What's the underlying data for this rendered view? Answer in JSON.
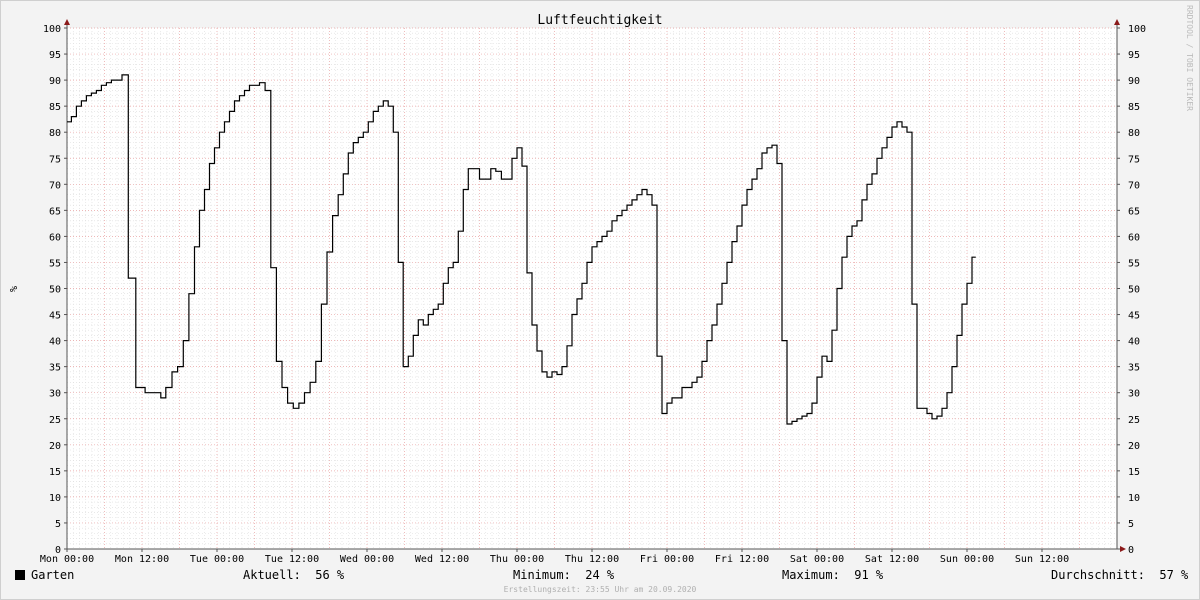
{
  "watermark": "RRDTOOL / TOBI OETIKER",
  "footer": "Erstellungszeit: 23:55 Uhr am 20.09.2020",
  "legend": {
    "series_name": "Garten",
    "current_label": "Aktuell:",
    "current_value": "56 %",
    "min_label": "Minimum:",
    "min_value": "24 %",
    "max_label": "Maximum:",
    "max_value": "91 %",
    "avg_label": "Durchschnitt:",
    "avg_value": "57 %"
  },
  "chart_data": {
    "type": "line",
    "title": "Luftfeuchtigkeit",
    "ylabel": "%",
    "ylim": [
      0,
      100
    ],
    "yticks": [
      0,
      5,
      10,
      15,
      20,
      25,
      30,
      35,
      40,
      45,
      50,
      55,
      60,
      65,
      70,
      75,
      80,
      85,
      90,
      95,
      100
    ],
    "xlim_hours": [
      0,
      168
    ],
    "xticks": [
      {
        "hour": 0,
        "label": "Mon 00:00"
      },
      {
        "hour": 12,
        "label": "Mon 12:00"
      },
      {
        "hour": 24,
        "label": "Tue 00:00"
      },
      {
        "hour": 36,
        "label": "Tue 12:00"
      },
      {
        "hour": 48,
        "label": "Wed 00:00"
      },
      {
        "hour": 60,
        "label": "Wed 12:00"
      },
      {
        "hour": 72,
        "label": "Thu 00:00"
      },
      {
        "hour": 84,
        "label": "Thu 12:00"
      },
      {
        "hour": 96,
        "label": "Fri 00:00"
      },
      {
        "hour": 108,
        "label": "Fri 12:00"
      },
      {
        "hour": 120,
        "label": "Sat 00:00"
      },
      {
        "hour": 132,
        "label": "Sat 12:00"
      },
      {
        "hour": 144,
        "label": "Sun 00:00"
      },
      {
        "hour": 156,
        "label": "Sun 12:00"
      }
    ],
    "grid": true,
    "color": "#000000",
    "series": [
      {
        "name": "Garten",
        "points": [
          [
            0,
            82
          ],
          [
            0.7,
            83
          ],
          [
            1.5,
            85
          ],
          [
            2.3,
            86
          ],
          [
            3.1,
            87
          ],
          [
            3.9,
            87.5
          ],
          [
            4.7,
            88
          ],
          [
            5.5,
            89
          ],
          [
            6.3,
            89.5
          ],
          [
            7.1,
            90
          ],
          [
            8.8,
            91
          ],
          [
            9.8,
            52
          ],
          [
            11,
            31
          ],
          [
            12.5,
            30
          ],
          [
            14.3,
            30
          ],
          [
            15,
            29
          ],
          [
            15.8,
            31
          ],
          [
            16.8,
            34
          ],
          [
            17.7,
            35
          ],
          [
            18.6,
            40
          ],
          [
            19.5,
            49
          ],
          [
            20.4,
            58
          ],
          [
            21.2,
            65
          ],
          [
            22,
            69
          ],
          [
            22.8,
            74
          ],
          [
            23.6,
            77
          ],
          [
            24.4,
            80
          ],
          [
            25.2,
            82
          ],
          [
            26,
            84
          ],
          [
            26.8,
            86
          ],
          [
            27.6,
            87
          ],
          [
            28.4,
            88
          ],
          [
            29.2,
            89
          ],
          [
            30,
            89
          ],
          [
            30.8,
            89.5
          ],
          [
            31.7,
            88
          ],
          [
            32.6,
            54
          ],
          [
            33.5,
            36
          ],
          [
            34.4,
            31
          ],
          [
            35.3,
            28
          ],
          [
            36.2,
            27
          ],
          [
            37.1,
            28
          ],
          [
            38,
            30
          ],
          [
            38.9,
            32
          ],
          [
            39.8,
            36
          ],
          [
            40.7,
            47
          ],
          [
            41.6,
            57
          ],
          [
            42.5,
            64
          ],
          [
            43.4,
            68
          ],
          [
            44.2,
            72
          ],
          [
            45,
            76
          ],
          [
            45.8,
            78
          ],
          [
            46.6,
            79
          ],
          [
            47.4,
            80
          ],
          [
            48.2,
            82
          ],
          [
            49,
            84
          ],
          [
            49.8,
            85
          ],
          [
            50.6,
            86
          ],
          [
            51.4,
            85
          ],
          [
            52.2,
            80
          ],
          [
            53,
            55
          ],
          [
            53.8,
            35
          ],
          [
            54.6,
            37
          ],
          [
            55.4,
            41
          ],
          [
            56.2,
            44
          ],
          [
            57,
            43
          ],
          [
            57.8,
            45
          ],
          [
            58.6,
            46
          ],
          [
            59.4,
            47
          ],
          [
            60.2,
            51
          ],
          [
            61,
            54
          ],
          [
            61.8,
            55
          ],
          [
            62.6,
            61
          ],
          [
            63.4,
            69
          ],
          [
            64.2,
            73
          ],
          [
            65,
            73
          ],
          [
            66,
            71
          ],
          [
            67,
            71
          ],
          [
            67.8,
            73
          ],
          [
            68.6,
            72.5
          ],
          [
            69.5,
            71
          ],
          [
            70.4,
            71
          ],
          [
            71.2,
            75
          ],
          [
            72,
            77
          ],
          [
            72.8,
            73.5
          ],
          [
            73.6,
            53
          ],
          [
            74.4,
            43
          ],
          [
            75.2,
            38
          ],
          [
            76,
            34
          ],
          [
            76.8,
            33
          ],
          [
            77.6,
            34
          ],
          [
            78.4,
            33.5
          ],
          [
            79.2,
            35
          ],
          [
            80,
            39
          ],
          [
            80.8,
            45
          ],
          [
            81.6,
            48
          ],
          [
            82.4,
            51
          ],
          [
            83.2,
            55
          ],
          [
            84,
            58
          ],
          [
            84.8,
            59
          ],
          [
            85.6,
            60
          ],
          [
            86.4,
            61
          ],
          [
            87.2,
            63
          ],
          [
            88,
            64
          ],
          [
            88.8,
            65
          ],
          [
            89.6,
            66
          ],
          [
            90.4,
            67
          ],
          [
            91.2,
            68
          ],
          [
            92,
            69
          ],
          [
            92.8,
            68
          ],
          [
            93.6,
            66
          ],
          [
            94.4,
            37
          ],
          [
            95.2,
            26
          ],
          [
            96,
            28
          ],
          [
            96.8,
            29
          ],
          [
            97.6,
            29
          ],
          [
            98.4,
            31
          ],
          [
            99.2,
            31
          ],
          [
            100,
            32
          ],
          [
            100.8,
            33
          ],
          [
            101.6,
            36
          ],
          [
            102.4,
            40
          ],
          [
            103.2,
            43
          ],
          [
            104,
            47
          ],
          [
            104.8,
            51
          ],
          [
            105.6,
            55
          ],
          [
            106.4,
            59
          ],
          [
            107.2,
            62
          ],
          [
            108,
            66
          ],
          [
            108.8,
            69
          ],
          [
            109.6,
            71
          ],
          [
            110.4,
            73
          ],
          [
            111.2,
            76
          ],
          [
            112,
            77
          ],
          [
            112.8,
            77.5
          ],
          [
            113.6,
            74
          ],
          [
            114.4,
            40
          ],
          [
            115.2,
            24
          ],
          [
            116,
            24.5
          ],
          [
            116.8,
            25
          ],
          [
            117.6,
            25.5
          ],
          [
            118.4,
            26
          ],
          [
            119.2,
            28
          ],
          [
            120,
            33
          ],
          [
            120.8,
            37
          ],
          [
            121.6,
            36
          ],
          [
            122.4,
            42
          ],
          [
            123.2,
            50
          ],
          [
            124,
            56
          ],
          [
            124.8,
            60
          ],
          [
            125.6,
            62
          ],
          [
            126.4,
            63
          ],
          [
            127.2,
            67
          ],
          [
            128,
            70
          ],
          [
            128.8,
            72
          ],
          [
            129.6,
            75
          ],
          [
            130.4,
            77
          ],
          [
            131.2,
            79
          ],
          [
            132,
            81
          ],
          [
            132.8,
            82
          ],
          [
            133.6,
            81
          ],
          [
            134.4,
            80
          ],
          [
            135.2,
            47
          ],
          [
            136,
            27
          ],
          [
            136.8,
            27
          ],
          [
            137.6,
            26
          ],
          [
            138.4,
            25
          ],
          [
            139.2,
            25.5
          ],
          [
            140,
            27
          ],
          [
            140.8,
            30
          ],
          [
            141.6,
            35
          ],
          [
            142.4,
            41
          ],
          [
            143.2,
            47
          ],
          [
            144,
            51
          ],
          [
            144.8,
            56
          ],
          [
            145.4,
            56
          ]
        ]
      }
    ]
  }
}
